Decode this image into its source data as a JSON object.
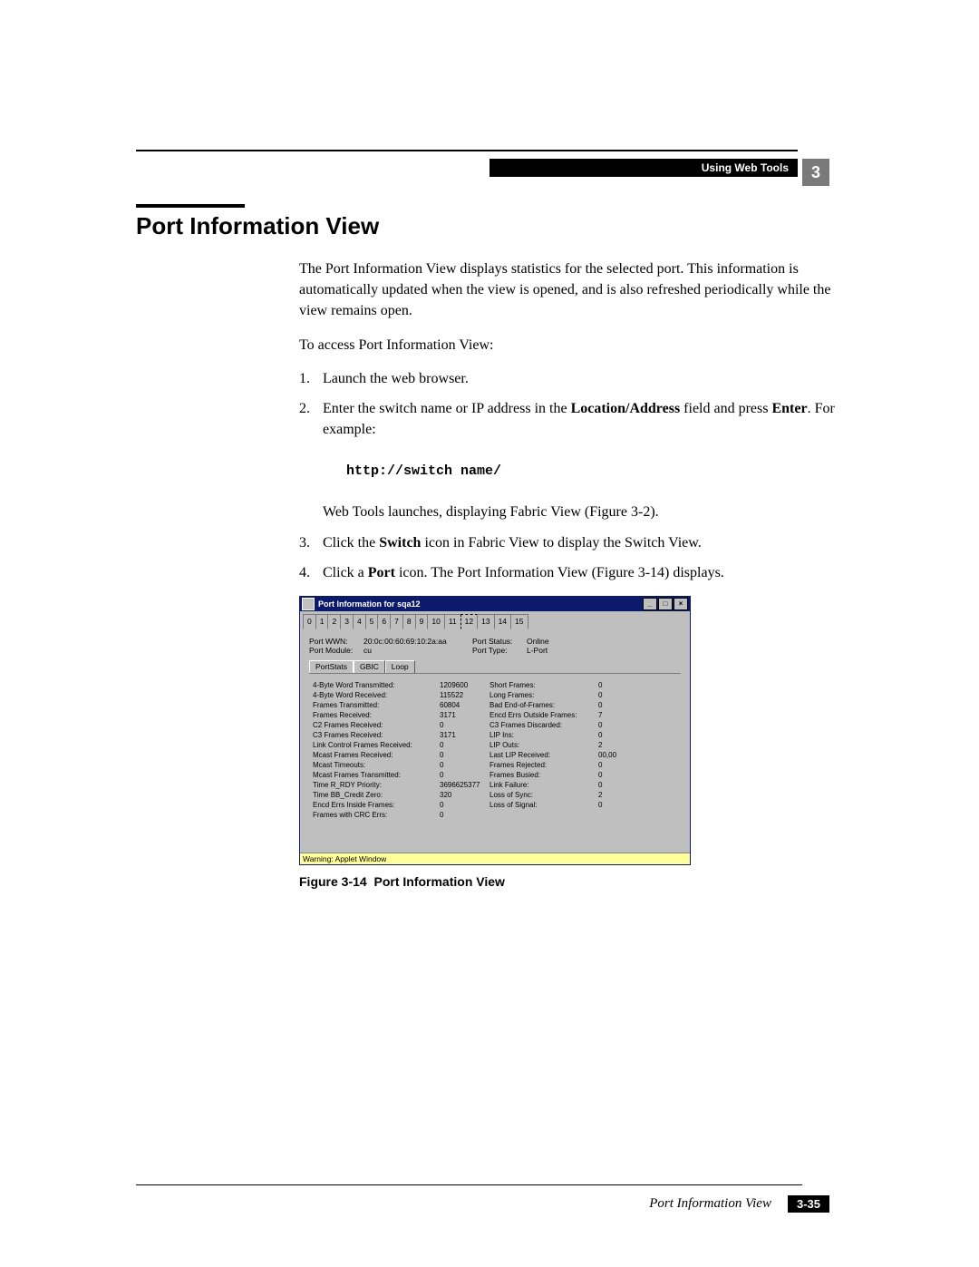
{
  "header": {
    "section": "Using Web Tools",
    "chapter": "3"
  },
  "title": "Port Information View",
  "intro": "The Port Information View displays statistics for the selected port. This information is automatically updated when the view is opened, and is also refreshed periodically while the view remains open.",
  "access": "To access Port Information View:",
  "steps": {
    "s1": "Launch the web browser.",
    "s2a": "Enter the switch name or IP address in the ",
    "s2b": "Location/Address",
    "s2c": " field and press ",
    "s2d": "Enter",
    "s2e": ". For example:",
    "code": "http://switch name/",
    "after2": "Web Tools launches, displaying Fabric View (Figure 3-2).",
    "s3a": "Click the ",
    "s3b": "Switch",
    "s3c": " icon in Fabric View to display the Switch View.",
    "s4a": "Click a ",
    "s4b": "Port",
    "s4c": " icon. The Port Information View (Figure 3-14) displays."
  },
  "dialog": {
    "title": "Port Information for sqa12",
    "winbtns": {
      "min": "_",
      "max": "□",
      "close": "×"
    },
    "portTabs": [
      "0",
      "1",
      "2",
      "3",
      "4",
      "5",
      "6",
      "7",
      "8",
      "9",
      "10",
      "11",
      "12",
      "13",
      "14",
      "15"
    ],
    "selectedPortTab": "12",
    "info": {
      "wwn_l": "Port WWN:",
      "wwn_v": "20:0c:00:60:69:10:2a:aa",
      "mod_l": "Port Module:",
      "mod_v": "cu",
      "status_l": "Port Status:",
      "status_v": "Online",
      "type_l": "Port Type:",
      "type_v": "L-Port"
    },
    "subTabs": {
      "a": "PortStats",
      "b": "GBIC",
      "c": "Loop"
    },
    "stats": [
      [
        "4-Byte Word Transmitted:",
        "1209600",
        "Short Frames:",
        "0"
      ],
      [
        "4-Byte Word Received:",
        "115522",
        "Long Frames:",
        "0"
      ],
      [
        "Frames Transmitted:",
        "60804",
        "Bad End-of-Frames:",
        "0"
      ],
      [
        "Frames Received:",
        "3171",
        "Encd Errs Outside Frames:",
        "7"
      ],
      [
        "C2 Frames Received:",
        "0",
        "C3 Frames Discarded:",
        "0"
      ],
      [
        "C3 Frames Received:",
        "3171",
        "LIP Ins:",
        "0"
      ],
      [
        "Link Control Frames Received:",
        "0",
        "LIP Outs:",
        "2"
      ],
      [
        "Mcast Frames Received:",
        "0",
        "Last LIP Received:",
        "00,00"
      ],
      [
        "Mcast Timeouts:",
        "0",
        "Frames Rejected:",
        "0"
      ],
      [
        "Mcast Frames Transmitted:",
        "0",
        "Frames Busied:",
        "0"
      ],
      [
        "Time R_RDY Priority:",
        "3696625377",
        "Link Failure:",
        "0"
      ],
      [
        "Time BB_Credit Zero:",
        "320",
        "Loss of Sync:",
        "2"
      ],
      [
        "Encd Errs Inside Frames:",
        "0",
        "Loss of Signal:",
        "0"
      ],
      [
        "Frames with CRC Errs:",
        "0",
        "",
        ""
      ]
    ],
    "warn": "Warning: Applet Window"
  },
  "figcap": {
    "num": "Figure 3-14",
    "title": "Port Information View"
  },
  "footer": {
    "title": "Port Information View",
    "page": "3-35"
  }
}
